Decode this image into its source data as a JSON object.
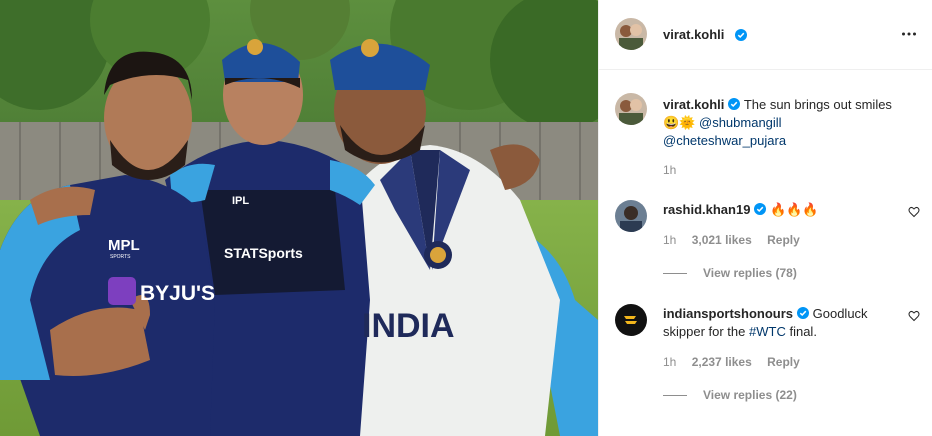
{
  "post": {
    "author": "virat.kohli",
    "more_icon": "more-options-icon"
  },
  "photo": {
    "description_alt": "Three cricketers in team kit smiling outdoors",
    "jersey_left": {
      "sponsor_top": "MPL",
      "sponsor_sub": "SPORTS",
      "sponsor_main": "BYJU'S"
    },
    "jersey_middle": {
      "vest_top": "IPL",
      "vest_main": "STATSports"
    },
    "jersey_right": {
      "chest_text": "INDIA"
    }
  },
  "caption": {
    "username": "virat.kohli",
    "text": "The sun brings out smiles",
    "emojis": "😃🌞",
    "mention_1": "@shubmangill",
    "mention_2": "@cheteshwar_pujara",
    "time": "1h"
  },
  "comments": [
    {
      "username": "rashid.khan19",
      "verified": true,
      "text": "🔥🔥🔥",
      "time": "1h",
      "likes": "3,021 likes",
      "reply": "Reply",
      "view_replies": "View replies (78)"
    },
    {
      "username": "indiansportshonours",
      "verified": true,
      "text": "Goodluck skipper for the",
      "hashtag": "#WTC",
      "text_after": "final.",
      "time": "1h",
      "likes": "2,237 likes",
      "reply": "Reply",
      "view_replies": "View replies (22)"
    }
  ],
  "colors": {
    "verified_blue": "#0095f6",
    "mention_blue": "#00376b",
    "secondary_text": "#8e8e8e",
    "primary_text": "#262626"
  }
}
